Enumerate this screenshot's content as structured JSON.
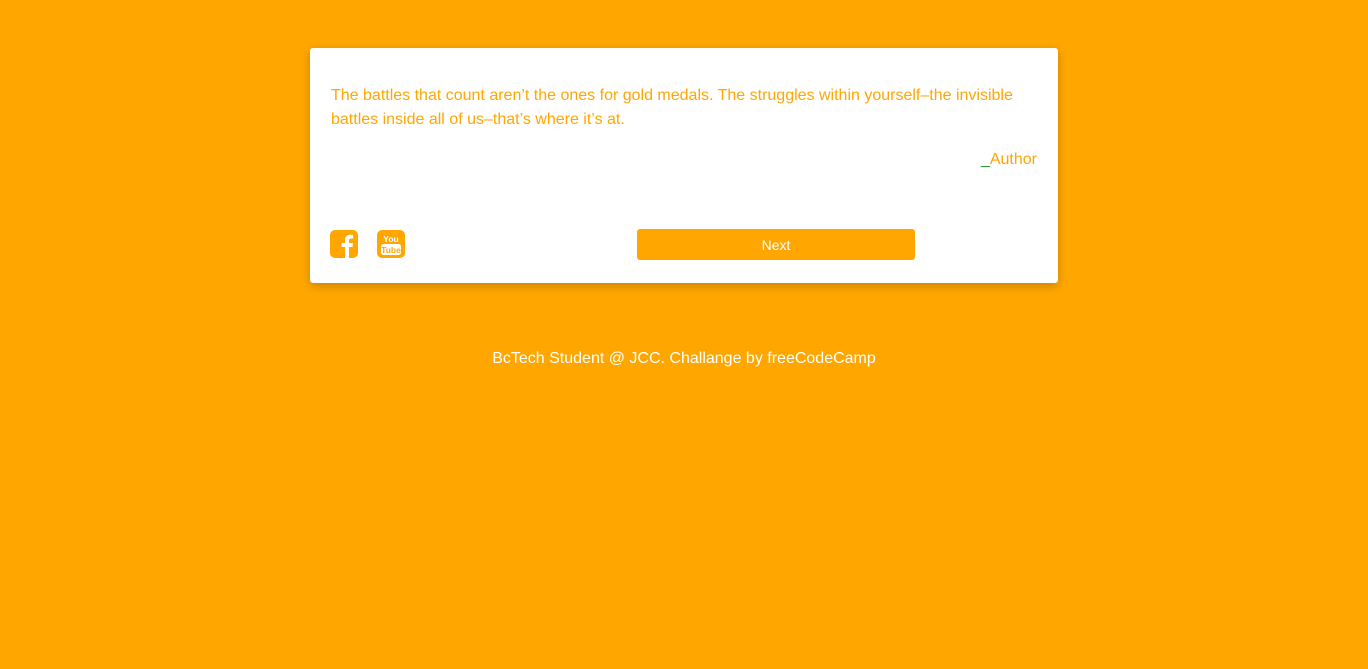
{
  "colors": {
    "background": "#FFA700",
    "card": "#FFFFFF",
    "accent": "#FFA700",
    "author_dash": "#2E9A2E"
  },
  "quote": {
    "text": "The battles that count aren’t the ones for gold medals. The struggles within yourself–the invisible battles inside all of us–that’s where it’s at.",
    "author_prefix": "_",
    "author": "Author"
  },
  "social": {
    "facebook_icon": "facebook-square-icon",
    "youtube_icon": "youtube-square-icon"
  },
  "buttons": {
    "next_label": "Next"
  },
  "footer": {
    "text": "BcTech Student @ JCC. Challange by freeCodeCamp"
  }
}
